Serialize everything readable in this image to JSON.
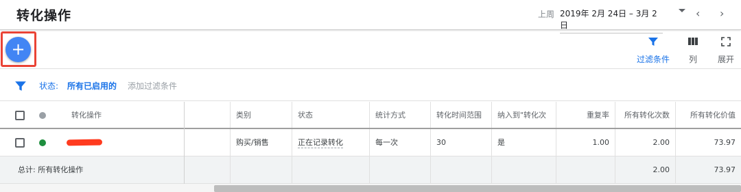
{
  "header": {
    "title": "转化操作",
    "date_prefix": "上周",
    "date_range": "2019年 2月 24日 – 3月 2日",
    "prev_icon": "‹",
    "next_icon": "›"
  },
  "toolbar": {
    "add_icon": "+",
    "filter_label": "过滤条件",
    "columns_label": "列",
    "expand_label": "展开"
  },
  "filter": {
    "label": "状态:",
    "value": "所有已启用的",
    "add_label": "添加过滤条件"
  },
  "table": {
    "headers": {
      "name": "转化操作",
      "category": "类别",
      "status": "状态",
      "counting": "统计方式",
      "window": "转化时间范围",
      "include": "纳入到\"转化次",
      "repeat": "重复率",
      "all_conv": "所有转化次数",
      "all_value": "所有转化价值"
    },
    "rows": [
      {
        "category": "购买/销售",
        "status": "正在记录转化",
        "counting": "每一次",
        "window": "30",
        "include": "是",
        "repeat": "1.00",
        "all_conv": "2.00",
        "all_value": "73.97"
      }
    ],
    "total": {
      "label": "总计: 所有转化操作",
      "all_conv": "2.00",
      "all_value": "73.97"
    }
  },
  "colors": {
    "accent": "#1a73e8",
    "fab": "#4285f4",
    "highlight": "#ea4335",
    "status_green": "#1e8e3e"
  }
}
